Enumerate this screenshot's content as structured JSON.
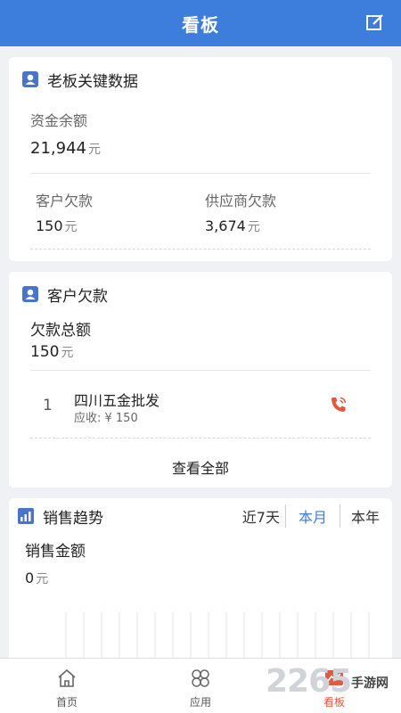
{
  "header": {
    "title": "看板",
    "edit_icon": "edit-icon"
  },
  "boss": {
    "title": "老板关键数据",
    "balance_label": "资金余额",
    "balance_value": "21,944",
    "balance_unit": "元",
    "cust_debt_label": "客户欠款",
    "cust_debt_value": "150",
    "cust_debt_unit": "元",
    "supp_debt_label": "供应商欠款",
    "supp_debt_value": "3,674",
    "supp_debt_unit": "元"
  },
  "customer": {
    "title": "客户欠款",
    "total_label": "欠款总额",
    "total_value": "150",
    "total_unit": "元",
    "items": [
      {
        "index": "1",
        "name": "四川五金批发",
        "detail": "应收: ¥ 150"
      }
    ],
    "view_all": "查看全部"
  },
  "sales": {
    "title": "销售趋势",
    "tabs": [
      "近7天",
      "本月",
      "本年"
    ],
    "active_tab": "本月",
    "amount_label": "销售金额",
    "amount_value": "0",
    "amount_unit": "元"
  },
  "tabbar": {
    "items": [
      {
        "label": "首页",
        "icon": "home-icon"
      },
      {
        "label": "应用",
        "icon": "apps-icon"
      },
      {
        "label": "看板",
        "icon": "dashboard-icon"
      }
    ]
  },
  "watermark": {
    "number": "2265",
    "text": "手游网"
  },
  "colors": {
    "primary": "#3d7ddb",
    "phone": "#e05a3f"
  }
}
